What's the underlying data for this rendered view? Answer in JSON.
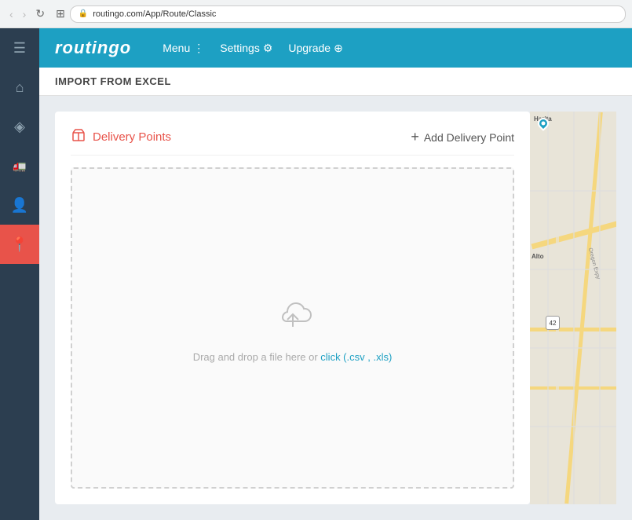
{
  "browser": {
    "url": "routingo.com/App/Route/Classic",
    "back_enabled": false,
    "forward_enabled": false
  },
  "header": {
    "logo": "routingo",
    "nav": [
      {
        "label": "Menu",
        "icon": "⋮"
      },
      {
        "label": "Settings",
        "icon": "⚙"
      },
      {
        "label": "Upgrade",
        "icon": "⊕"
      }
    ]
  },
  "sidebar": {
    "items": [
      {
        "icon": "☰",
        "name": "menu",
        "active": false
      },
      {
        "icon": "⌂",
        "name": "home",
        "active": false
      },
      {
        "icon": "◉",
        "name": "routes",
        "active": false
      },
      {
        "icon": "🚛",
        "name": "trucks",
        "active": false
      },
      {
        "icon": "👤",
        "name": "contacts",
        "active": false
      },
      {
        "icon": "📍",
        "name": "location",
        "active": true
      }
    ]
  },
  "page": {
    "title": "IMPORT FROM EXCEL",
    "delivery_points_label": "Delivery Points",
    "add_delivery_label": "Add Delivery Point",
    "drop_zone_text": "Drag and drop a file here or click (.csv , .xls)"
  },
  "map": {
    "location_label": "Harita",
    "alt_label": "Alto"
  }
}
